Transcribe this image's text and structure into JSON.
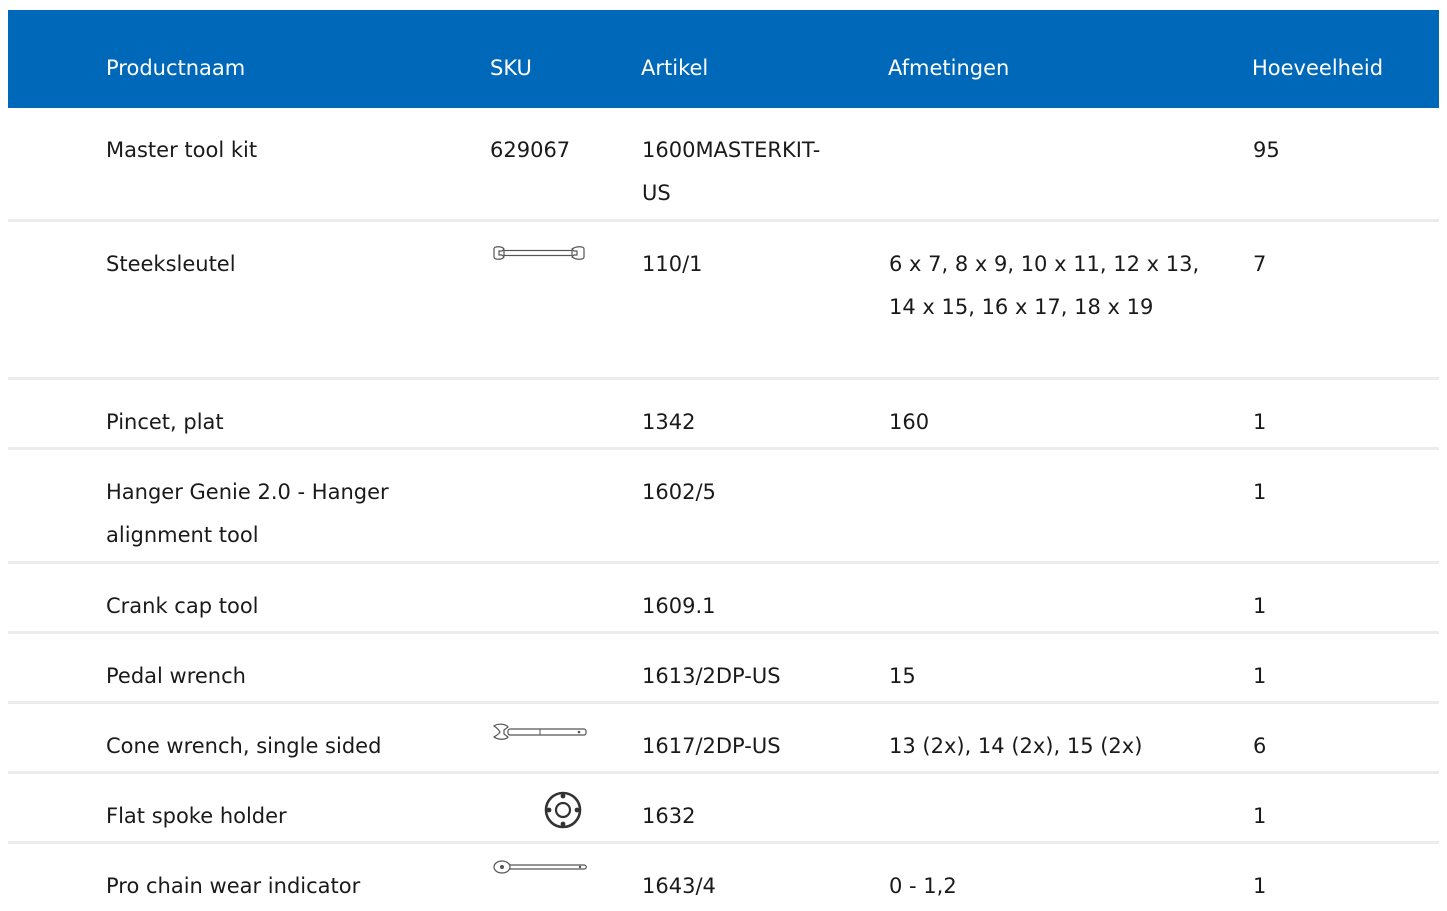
{
  "header": {
    "col_name": "Productnaam",
    "col_sku": "SKU",
    "col_article": "Artikel",
    "col_dimensions": "Afmetingen",
    "col_quantity": "Hoeveelheid"
  },
  "rows": [
    {
      "name": "Master tool kit",
      "sku": "629067",
      "article": "1600MASTERKIT-US",
      "dimensions": "",
      "quantity": "95",
      "icon": ""
    },
    {
      "name": "Steeksleutel",
      "sku": "",
      "article": "110/1",
      "dimensions": "6 x 7, 8 x 9, 10 x 11, 12 x 13, 14 x 15, 16 x 17, 18 x 19",
      "quantity": "7",
      "icon": "open-end-wrench-icon"
    },
    {
      "name": "Pincet, plat",
      "sku": "",
      "article": "1342",
      "dimensions": "160",
      "quantity": "1",
      "icon": ""
    },
    {
      "name": "Hanger Genie 2.0 - Hanger alignment tool",
      "sku": "",
      "article": "1602/5",
      "dimensions": "",
      "quantity": "1",
      "icon": ""
    },
    {
      "name": "Crank cap tool",
      "sku": "",
      "article": "1609.1",
      "dimensions": "",
      "quantity": "1",
      "icon": ""
    },
    {
      "name": "Pedal wrench",
      "sku": "",
      "article": "1613/2DP-US",
      "dimensions": "15",
      "quantity": "1",
      "icon": ""
    },
    {
      "name": "Cone wrench, single sided",
      "sku": "",
      "article": "1617/2DP-US",
      "dimensions": "13 (2x), 14 (2x), 15 (2x)",
      "quantity": "6",
      "icon": "cone-wrench-icon"
    },
    {
      "name": "Flat spoke holder",
      "sku": "",
      "article": "1632",
      "dimensions": "",
      "quantity": "1",
      "icon": "spoke-holder-icon"
    },
    {
      "name": "Pro chain wear indicator",
      "sku": "",
      "article": "1643/4",
      "dimensions": "0 - 1,2",
      "quantity": "1",
      "icon": "chain-wear-indicator-icon"
    }
  ]
}
